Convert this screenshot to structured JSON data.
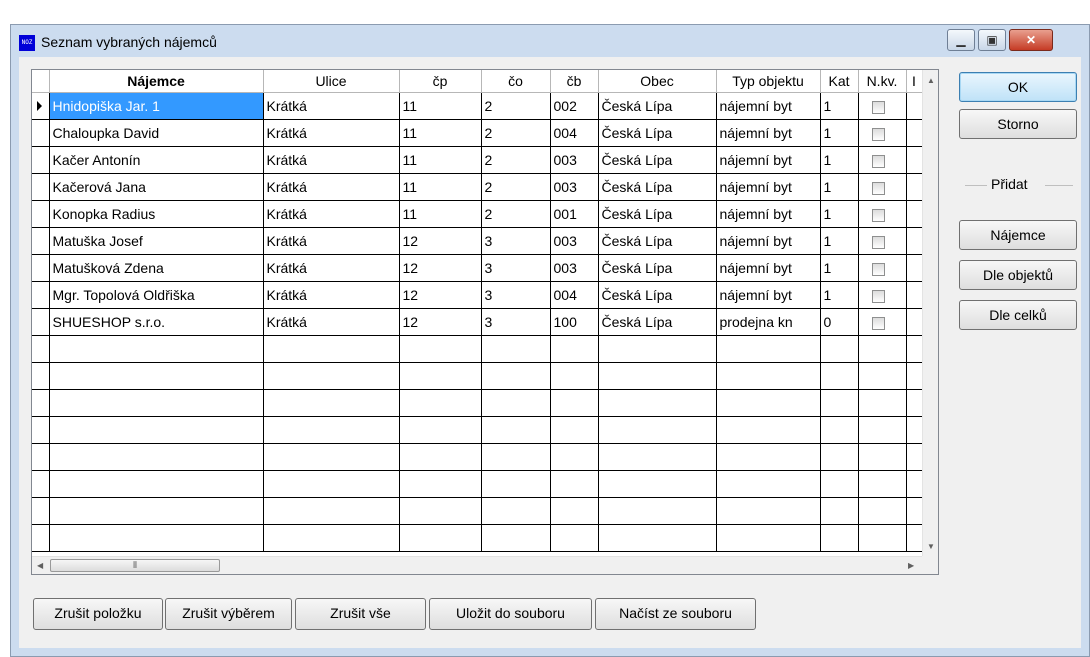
{
  "window": {
    "title": "Seznam vybraných nájemců",
    "icon_text": "NOZ"
  },
  "table": {
    "headers": [
      "Nájemce",
      "Ulice",
      "čp",
      "čo",
      "čb",
      "Obec",
      "Typ objektu",
      "Kat",
      "N.kv.",
      "I"
    ],
    "rows": [
      {
        "name": "Hnidopiška Jar. 1",
        "street": "Krátká",
        "cp": "11",
        "co": "2",
        "cb": "002",
        "city": "Česká Lípa",
        "type": "nájemní byt",
        "kat": "1",
        "selected": true
      },
      {
        "name": "Chaloupka David",
        "street": "Krátká",
        "cp": "11",
        "co": "2",
        "cb": "004",
        "city": "Česká Lípa",
        "type": "nájemní byt",
        "kat": "1"
      },
      {
        "name": "Kačer Antonín",
        "street": "Krátká",
        "cp": "11",
        "co": "2",
        "cb": "003",
        "city": "Česká Lípa",
        "type": "nájemní byt",
        "kat": "1"
      },
      {
        "name": "Kačerová Jana",
        "street": "Krátká",
        "cp": "11",
        "co": "2",
        "cb": "003",
        "city": "Česká Lípa",
        "type": "nájemní byt",
        "kat": "1"
      },
      {
        "name": "Konopka Radius",
        "street": "Krátká",
        "cp": "11",
        "co": "2",
        "cb": "001",
        "city": "Česká Lípa",
        "type": "nájemní byt",
        "kat": "1"
      },
      {
        "name": "Matuška Josef",
        "street": "Krátká",
        "cp": "12",
        "co": "3",
        "cb": "003",
        "city": "Česká Lípa",
        "type": "nájemní byt",
        "kat": "1"
      },
      {
        "name": "Matušková Zdena",
        "street": "Krátká",
        "cp": "12",
        "co": "3",
        "cb": "003",
        "city": "Česká Lípa",
        "type": "nájemní byt",
        "kat": "1"
      },
      {
        "name": "Mgr. Topolová Oldřiška",
        "street": "Krátká",
        "cp": "12",
        "co": "3",
        "cb": "004",
        "city": "Česká Lípa",
        "type": "nájemní byt",
        "kat": "1"
      },
      {
        "name": "SHUESHOP s.r.o.",
        "street": "Krátká",
        "cp": "12",
        "co": "3",
        "cb": "100",
        "city": "Česká Lípa",
        "type": "prodejna kn",
        "kat": "0"
      }
    ],
    "empty_rows": 8
  },
  "buttons": {
    "ok": "OK",
    "cancel": "Storno",
    "add_group": "Přidat",
    "tenant": "Nájemce",
    "by_objects": "Dle objektů",
    "by_units": "Dle celků",
    "remove_item": "Zrušit položku",
    "remove_selection": "Zrušit výběrem",
    "remove_all": "Zrušit vše",
    "save_file": "Uložit do souboru",
    "load_file": "Načíst ze souboru"
  },
  "colors": {
    "selection": "#3399ff",
    "window_frame": "#ccdcef"
  }
}
